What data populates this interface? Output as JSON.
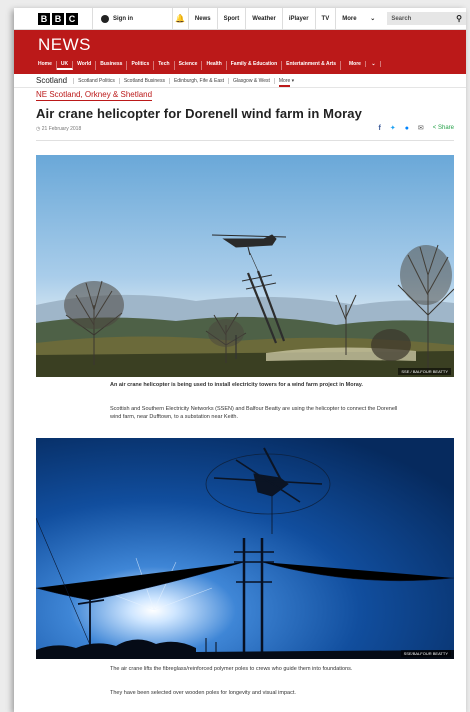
{
  "topbar": {
    "logo_letters": [
      "B",
      "B",
      "C"
    ],
    "signin_label": "Sign in",
    "links": [
      "News",
      "Sport",
      "Weather",
      "iPlayer",
      "TV"
    ],
    "more_label": "More",
    "search_placeholder": "Search"
  },
  "news": {
    "logo": "NEWS",
    "nav": [
      "Home",
      "UK",
      "World",
      "Business",
      "Politics",
      "Tech",
      "Science",
      "Health",
      "Family & Education",
      "Entertainment & Arts",
      "More"
    ],
    "active_nav": "UK"
  },
  "subnav": {
    "title": "Scotland",
    "items": [
      "Scotland Politics",
      "Scotland Business",
      "Edinburgh, Fife & East",
      "Glasgow & West"
    ],
    "more_label": "More"
  },
  "article": {
    "region": "NE Scotland, Orkney & Shetland",
    "headline": "Air crane helicopter for Dorenell wind farm in Moray",
    "date": "21 February 2018",
    "share_label": "Share",
    "image1_credit": "SSE / BALFOUR BEATTY",
    "caption1": "An air crane helicopter is being used to install electricity towers for a wind farm project in Moray.",
    "para1": "Scottish and Southern Electricity Networks (SSEN) and Balfour Beatty are using the helicopter to connect the Dorenell wind farm, near Dufftown, to a substation near Keith.",
    "image2_credit": "SSE/BALFOUR BEATTY",
    "para2": "The air crane lifts the fibreglass/reinforced polymer poles to crews who guide them into foundations.",
    "para3": "They have been selected over wooden poles for longevity and visual impact."
  }
}
